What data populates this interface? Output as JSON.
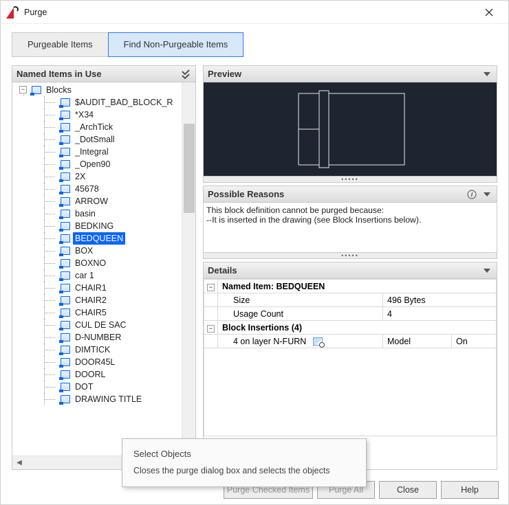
{
  "window": {
    "title": "Purge"
  },
  "tabs": {
    "purgeable": "Purgeable Items",
    "nonpurgeable": "Find Non-Purgeable Items"
  },
  "tree": {
    "header": "Named Items in Use",
    "root": "Blocks",
    "items": [
      "$AUDIT_BAD_BLOCK_R",
      "*X34",
      "_ArchTick",
      "_DotSmall",
      "_Integral",
      "_Open90",
      "2X",
      "45678",
      "ARROW",
      "basin",
      "BEDKING",
      "BEDQUEEN",
      "BOX",
      "BOXNO",
      "car 1",
      "CHAIR1",
      "CHAIR2",
      "CHAIR5",
      "CUL DE SAC",
      "D-NUMBER",
      "DIMTICK",
      "DOOR45L",
      "DOORL",
      "DOT",
      "DRAWING TITLE"
    ],
    "selectedIndex": 11
  },
  "preview": {
    "title": "Preview"
  },
  "reasons": {
    "title": "Possible Reasons",
    "line1": "This block definition cannot be purged because:",
    "line2": "--It is inserted in the drawing (see Block Insertions below)."
  },
  "details": {
    "title": "Details",
    "namedItemLabel": "Named Item: BEDQUEEN",
    "sizeLabel": "Size",
    "sizeValue": "496 Bytes",
    "usageLabel": "Usage Count",
    "usageValue": "4",
    "blockInsLabel": "Block Insertions (4)",
    "row1c1": "4 on layer N-FURN",
    "row1c2": "Model",
    "row1c3": "On"
  },
  "tooltip": {
    "title": "Select Objects",
    "body": "Closes the purge dialog box and selects the objects"
  },
  "buttons": {
    "purgeChecked": "Purge Checked Items",
    "purgeAll": "Purge All",
    "close": "Close",
    "help": "Help"
  }
}
